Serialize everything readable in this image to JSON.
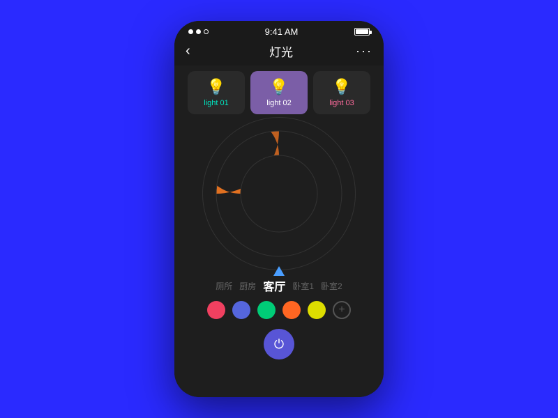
{
  "statusBar": {
    "time": "9:41 AM"
  },
  "nav": {
    "backLabel": "‹",
    "title": "灯光",
    "moreLabel": "···"
  },
  "lights": [
    {
      "id": "light-01",
      "label": "light 01",
      "active": false
    },
    {
      "id": "light-02",
      "label": "light 02",
      "active": true
    },
    {
      "id": "light-03",
      "label": "light 03",
      "active": false
    }
  ],
  "rooms": [
    {
      "label": "厕所",
      "active": false
    },
    {
      "label": "厨房",
      "active": false
    },
    {
      "label": "客厅",
      "active": true
    },
    {
      "label": "卧室1",
      "active": false
    },
    {
      "label": "卧室2",
      "active": false
    }
  ],
  "swatches": [
    {
      "color": "#f04060"
    },
    {
      "color": "#5566dd"
    },
    {
      "color": "#00cc77"
    },
    {
      "color": "#ff6622"
    },
    {
      "color": "#dddd00"
    }
  ],
  "addSwatchLabel": "+",
  "powerIcon": "⏻"
}
